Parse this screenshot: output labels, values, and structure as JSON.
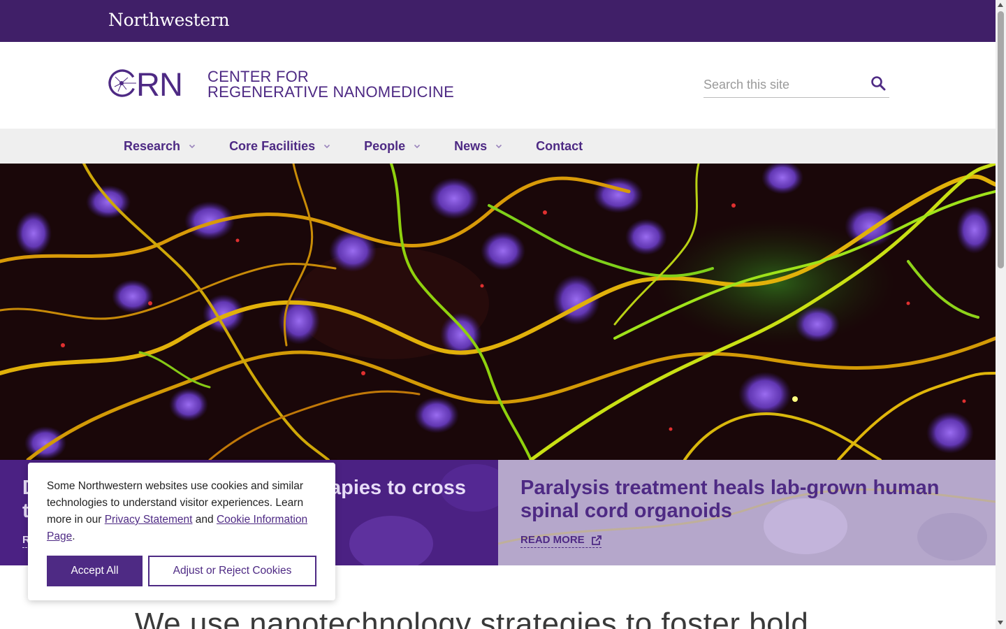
{
  "topbar": {
    "wordmark": "Northwestern"
  },
  "header": {
    "logo_mark_text": "CRN",
    "logo_line1": "CENTER FOR",
    "logo_line2": "REGENERATIVE NANOMEDICINE",
    "search_placeholder": "Search this site",
    "search_icon": "search-icon"
  },
  "nav": {
    "items": [
      {
        "label": "Research",
        "has_dropdown": true
      },
      {
        "label": "Core Facilities",
        "has_dropdown": true
      },
      {
        "label": "People",
        "has_dropdown": true
      },
      {
        "label": "News",
        "has_dropdown": true
      },
      {
        "label": "Contact",
        "has_dropdown": false
      }
    ]
  },
  "features": {
    "left": {
      "title": "D",
      "title_tail": "apies to cross",
      "title_line2_start": "t",
      "read_more": "R"
    },
    "right": {
      "title": "Paralysis treatment heals lab-grown human spinal cord organoids",
      "read_more": "READ MORE",
      "icon": "external-link-icon"
    }
  },
  "tagline": "We use nanotechnology strategies to foster bold",
  "cookie": {
    "text_before": "Some Northwestern websites use cookies and similar technologies to understand visitor experiences. Learn more in our ",
    "privacy_link": "Privacy Statement",
    "text_middle": " and ",
    "cookie_link": "Cookie Information Page",
    "text_end": ".",
    "accept_label": "Accept All",
    "adjust_label": "Adjust or Reject Cookies"
  },
  "colors": {
    "brand_purple": "#4e2a84",
    "topbar": "#401f68",
    "nav_bg": "#efefef"
  }
}
